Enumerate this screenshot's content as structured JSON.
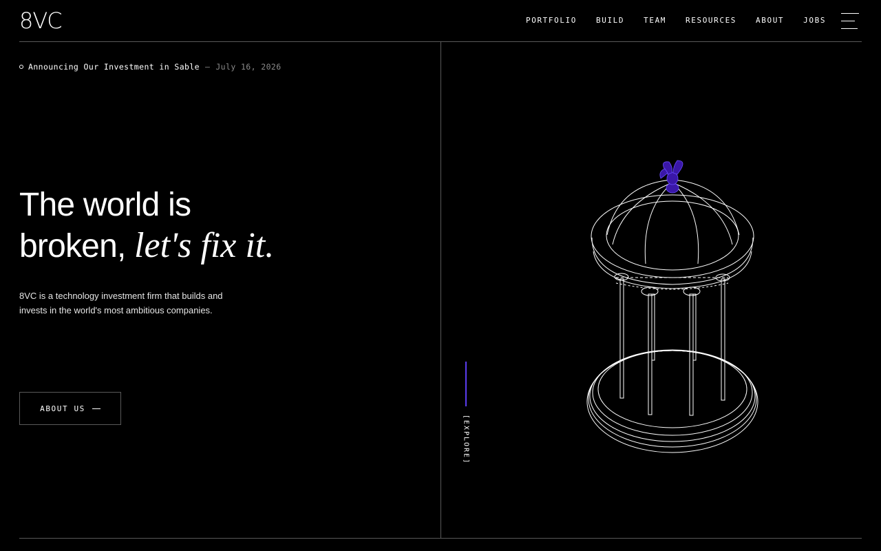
{
  "header": {
    "logo": "8VC",
    "nav": [
      {
        "label": "PORTFOLIO"
      },
      {
        "label": "BUILD"
      },
      {
        "label": "TEAM"
      },
      {
        "label": "RESOURCES"
      },
      {
        "label": "ABOUT"
      },
      {
        "label": "JOBS"
      }
    ],
    "menu_icon": "hamburger-menu-icon"
  },
  "announcement": {
    "icon": "circle-bullet-icon",
    "text": "Announcing Our Investment in Sable",
    "separator": "—",
    "date": "July 16, 2026"
  },
  "hero": {
    "line1": "The world is",
    "line2_plain": "broken, ",
    "line2_italic": "let's fix it.",
    "description": "8VC is a technology investment firm that builds and invests in the world's most ambitious companies."
  },
  "cta": {
    "label": "ABOUT US",
    "icon": "dash-arrow-icon"
  },
  "explore": {
    "label": "[EXPLORE]"
  },
  "colors": {
    "background": "#000000",
    "text": "#ffffff",
    "rule": "#5a5a5a",
    "accent": "#5b3df0",
    "finial": "#3a17a8"
  },
  "illustration": {
    "icon": "rotunda-temple-illustration"
  }
}
